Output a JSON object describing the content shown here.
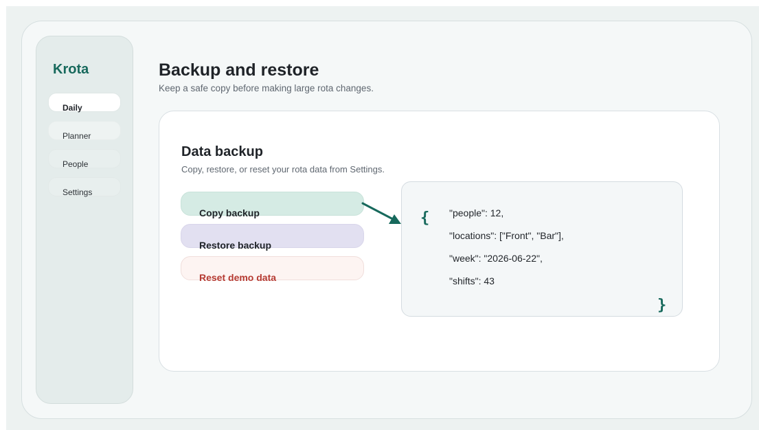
{
  "sidebar": {
    "brand": "Krota",
    "items": [
      {
        "label": "Daily",
        "active": true
      },
      {
        "label": "Planner",
        "active": false
      },
      {
        "label": "People",
        "active": false
      },
      {
        "label": "Settings",
        "active": false
      }
    ]
  },
  "header": {
    "title": "Backup and restore",
    "subtitle": "Keep a safe copy before making large rota changes."
  },
  "backup_card": {
    "title": "Data backup",
    "subtitle": "Copy, restore, or reset your rota data from Settings.",
    "actions": {
      "copy_label": "Copy backup",
      "restore_label": "Restore backup",
      "reset_label": "Reset demo data"
    },
    "json_preview": {
      "open_brace": "{",
      "close_brace": "}",
      "lines": [
        "\"people\": 12,",
        "\"locations\": [\"Front\", \"Bar\"],",
        "\"week\": \"2026-06-22\",",
        "\"shifts\": 43"
      ]
    }
  },
  "colors": {
    "accent": "#17695c",
    "copy_bg": "#d5ebe4",
    "restore_bg": "#e2e0f1",
    "reset_bg": "#fdf4f2",
    "reset_text": "#b53a32"
  }
}
